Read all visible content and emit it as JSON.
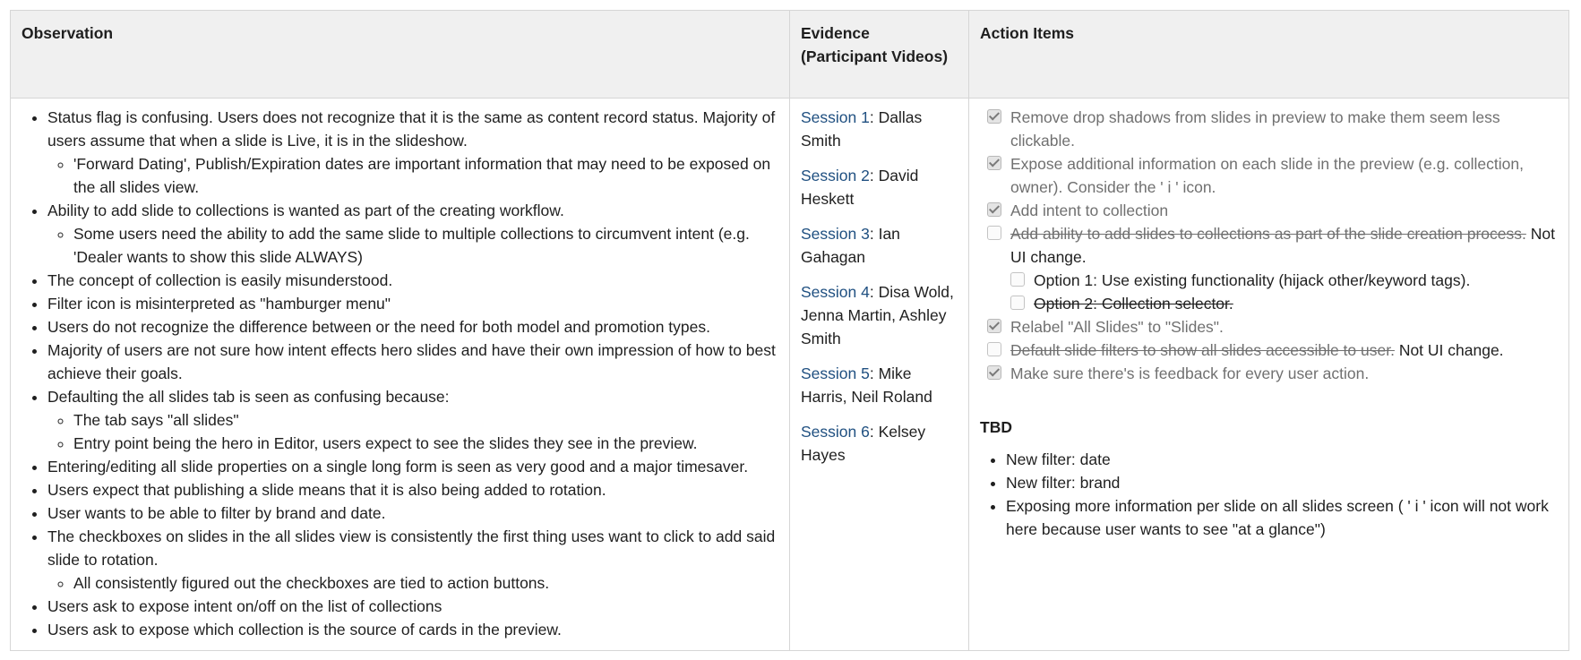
{
  "headers": {
    "observation": "Observation",
    "evidence": "Evidence (Participant Videos)",
    "actions": "Action Items"
  },
  "observations": {
    "o1": "Status flag is confusing. Users does not recognize that it is the same as content record status. Majority of users assume that when a slide is Live, it is in the slideshow.",
    "o1a": "'Forward Dating', Publish/Expiration dates are important information that may need to be exposed on the all slides view.",
    "o2": "Ability to add slide to collections is wanted as part of the creating workflow.",
    "o2a": "Some users need the ability to add the same slide to multiple collections to circumvent intent (e.g. 'Dealer wants to show this slide ALWAYS)",
    "o3": "The concept of collection is easily misunderstood.",
    "o4": "Filter icon is misinterpreted as \"hamburger menu\"",
    "o5": "Users do not recognize the difference between or the need for both model and promotion types.",
    "o6": "Majority of users are not sure how intent effects hero slides and have their own impression of how to best achieve their goals.",
    "o7": "Defaulting the all slides tab is seen as confusing because:",
    "o7a": "The tab says \"all slides\"",
    "o7b": "Entry point being the hero in Editor, users expect to see the slides they see in the preview.",
    "o8": "Entering/editing all slide properties on a single long form is seen as very good and a major timesaver.",
    "o9": "Users expect that publishing a slide means that it is also being added to rotation.",
    "o10": "User wants to be able to filter by brand and date.",
    "o11": "The checkboxes on slides in the all slides view is consistently the first thing uses want to click to add said slide to rotation.",
    "o11a": "All consistently figured out the checkboxes are tied to action buttons.",
    "o12": "Users ask to expose intent on/off on the list of collections",
    "o13": "Users ask to expose which collection is the source of cards in the preview."
  },
  "sessions": [
    {
      "link": "Session 1",
      "names": ": Dallas Smith"
    },
    {
      "link": "Session 2",
      "names": ": David Heskett"
    },
    {
      "link": "Session 3",
      "names": ": Ian Gahagan"
    },
    {
      "link": "Session 4",
      "names": ": Disa Wold, Jenna Martin, Ashley Smith"
    },
    {
      "link": "Session 5",
      "names": ": Mike Harris, Neil Roland"
    },
    {
      "link": "Session 6",
      "names": ": Kelsey Hayes"
    }
  ],
  "actions": {
    "a1": "Remove drop shadows from slides in preview to make them seem less clickable.",
    "a2": "Expose additional information on each slide in the preview (e.g. collection, owner). Consider the ' i ' icon.",
    "a3": "Add intent to collection",
    "a4_struck": "Add ability to add slides to collections as part of the slide creation process.",
    "a4_note": " Not UI change.",
    "a4_opt1": "Option 1: Use existing functionality (hijack other/keyword tags).",
    "a4_opt2": "Option 2: Collection selector.",
    "a5": "Relabel \"All Slides\" to \"Slides\".",
    "a6_struck": "Default slide filters to show all slides accessible to user.",
    "a6_note": " Not UI change.",
    "a7": "Make sure there's is feedback for every user action."
  },
  "tbd": {
    "title": "TBD",
    "items": [
      "New filter: date",
      "New filter: brand",
      "Exposing more information per slide on all slides screen ( ' i ' icon will not work here because user wants to see \"at a glance\")"
    ]
  }
}
